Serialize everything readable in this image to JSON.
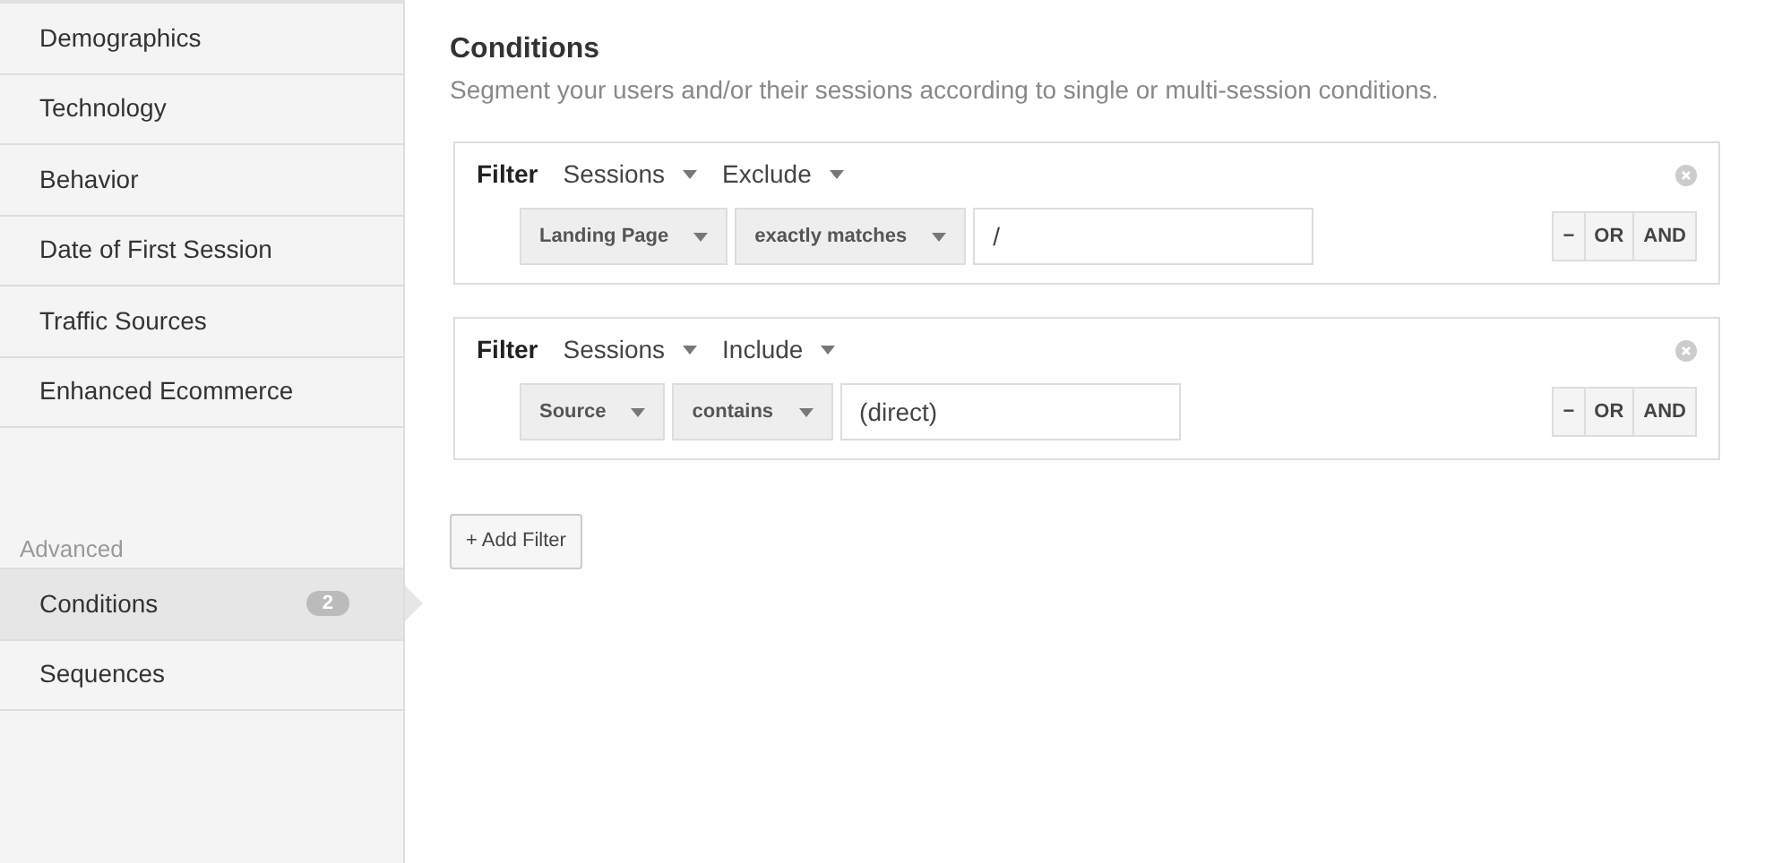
{
  "sidebar": {
    "items": [
      {
        "label": "Demographics",
        "selected": false
      },
      {
        "label": "Technology",
        "selected": false
      },
      {
        "label": "Behavior",
        "selected": false
      },
      {
        "label": "Date of First Session",
        "selected": false
      },
      {
        "label": "Traffic Sources",
        "selected": false
      },
      {
        "label": "Enhanced Ecommerce",
        "selected": false
      }
    ],
    "section": "Advanced",
    "advanced_items": [
      {
        "label": "Conditions",
        "badge": "2",
        "selected": true
      },
      {
        "label": "Sequences",
        "selected": false
      }
    ]
  },
  "header": {
    "title": "Conditions",
    "subtitle": "Segment your users and/or their sessions according to single or multi-session conditions."
  },
  "filters": [
    {
      "label": "Filter",
      "scope": "Sessions",
      "mode": "Exclude",
      "dimension": "Landing Page",
      "operator": "exactly matches",
      "value": "/",
      "buttons": [
        "−",
        "OR",
        "AND"
      ]
    },
    {
      "label": "Filter",
      "scope": "Sessions",
      "mode": "Include",
      "dimension": "Source",
      "operator": "contains",
      "value": "(direct)",
      "buttons": [
        "−",
        "OR",
        "AND"
      ]
    }
  ],
  "add_button": "+ Add Filter"
}
